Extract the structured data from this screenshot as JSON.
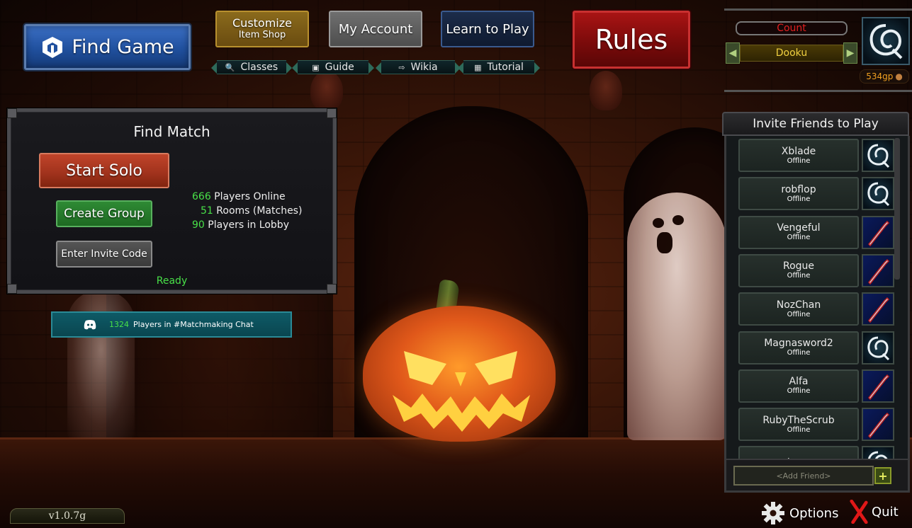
{
  "top_nav": {
    "find_game": "Find Game",
    "customize": "Customize",
    "customize_sub": "Item Shop",
    "my_account": "My Account",
    "learn_to_play": "Learn to Play",
    "rules": "Rules",
    "links": {
      "classes": "Classes",
      "guide": "Guide",
      "wikia": "Wikia",
      "tutorial": "Tutorial"
    }
  },
  "account": {
    "rank": "Count",
    "name": "Dooku",
    "gold": "534gp"
  },
  "find_match": {
    "title": "Find Match",
    "start_solo": "Start Solo",
    "create_group": "Create Group",
    "enter_invite_code": "Enter Invite Code",
    "players_online_num": "666",
    "players_online_label": " Players Online",
    "rooms_num": "51",
    "rooms_label": " Rooms (Matches)",
    "lobby_num": "90",
    "lobby_label": " Players in Lobby",
    "status": "Ready"
  },
  "discord": {
    "count": "1324",
    "label": "Players in #Matchmaking Chat"
  },
  "friends": {
    "title": "Invite Friends to Play",
    "add_placeholder": "<Add Friend>",
    "add_button": "+",
    "list": [
      {
        "name": "Xblade",
        "status": "Offline",
        "avatar": "logo-icon"
      },
      {
        "name": "robflop",
        "status": "Offline",
        "avatar": "logo-icon"
      },
      {
        "name": "Vengeful",
        "status": "Offline",
        "avatar": "sword-icon"
      },
      {
        "name": "Rogue",
        "status": "Offline",
        "avatar": "sword-icon"
      },
      {
        "name": "NozChan",
        "status": "Offline",
        "avatar": "sword-icon"
      },
      {
        "name": "Magnasword2",
        "status": "Offline",
        "avatar": "logo-icon"
      },
      {
        "name": "Alfa",
        "status": "Offline",
        "avatar": "sword-icon"
      },
      {
        "name": "RubyTheScrub",
        "status": "Offline",
        "avatar": "sword-icon"
      },
      {
        "name": "cbman",
        "status": "",
        "avatar": "logo-icon"
      }
    ]
  },
  "footer": {
    "version": "v1.0.7g",
    "options": "Options",
    "quit": "Quit"
  },
  "colors": {
    "find_game_blue": "#20509e",
    "rules_red": "#780a0a",
    "online_green": "#48e048",
    "gold_text": "#f0a020",
    "rank_red": "#e02020"
  }
}
